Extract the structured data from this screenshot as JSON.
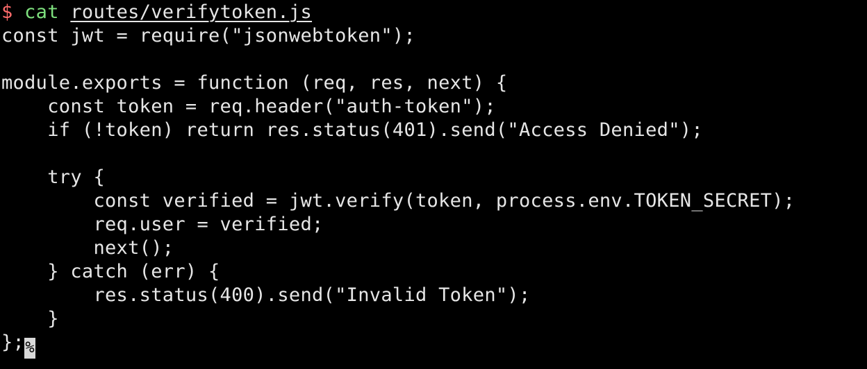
{
  "terminal": {
    "prompt": {
      "symbol": "$",
      "command": "cat",
      "path": "routes/verifytoken.js"
    },
    "lines": [
      "const jwt = require(\"jsonwebtoken\");",
      "",
      "module.exports = function (req, res, next) {",
      "    const token = req.header(\"auth-token\");",
      "    if (!token) return res.status(401).send(\"Access Denied\");",
      "",
      "    try {",
      "        const verified = jwt.verify(token, process.env.TOKEN_SECRET);",
      "        req.user = verified;",
      "        next();",
      "    } catch (err) {",
      "        res.status(400).send(\"Invalid Token\");",
      "    }"
    ],
    "last_line": "};",
    "cursor_char": "%",
    "colors": {
      "background": "#000000",
      "text": "#e6e6e6",
      "prompt_symbol": "#ff6b6b",
      "prompt_command": "#7ee07e",
      "cursor": "#d9d9d9"
    }
  }
}
